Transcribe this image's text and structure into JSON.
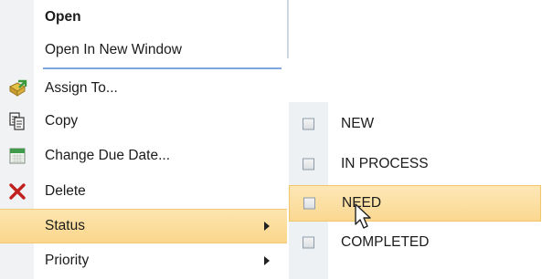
{
  "menu": {
    "items": [
      {
        "label": "Open",
        "icon": "",
        "bold": true
      },
      {
        "label": "Open In New Window",
        "icon": ""
      },
      {
        "label": "Assign To...",
        "icon": "assign-icon"
      },
      {
        "label": "Copy",
        "icon": "copy-icon"
      },
      {
        "label": "Change Due Date...",
        "icon": "calendar-icon"
      },
      {
        "label": "Delete",
        "icon": "delete-icon"
      },
      {
        "label": "Status",
        "icon": "",
        "has_submenu": true,
        "highlighted": true
      },
      {
        "label": "Priority",
        "icon": "",
        "has_submenu": true
      }
    ]
  },
  "status_submenu": {
    "items": [
      {
        "label": "NEW",
        "checked": false
      },
      {
        "label": "IN PROCESS",
        "checked": false
      },
      {
        "label": "NEED",
        "checked": false,
        "highlighted": true
      },
      {
        "label": "COMPLETED",
        "checked": false
      }
    ]
  },
  "colors": {
    "highlight": "#fbd68c",
    "separator": "#7ea6e0",
    "delete": "#c0211f"
  }
}
